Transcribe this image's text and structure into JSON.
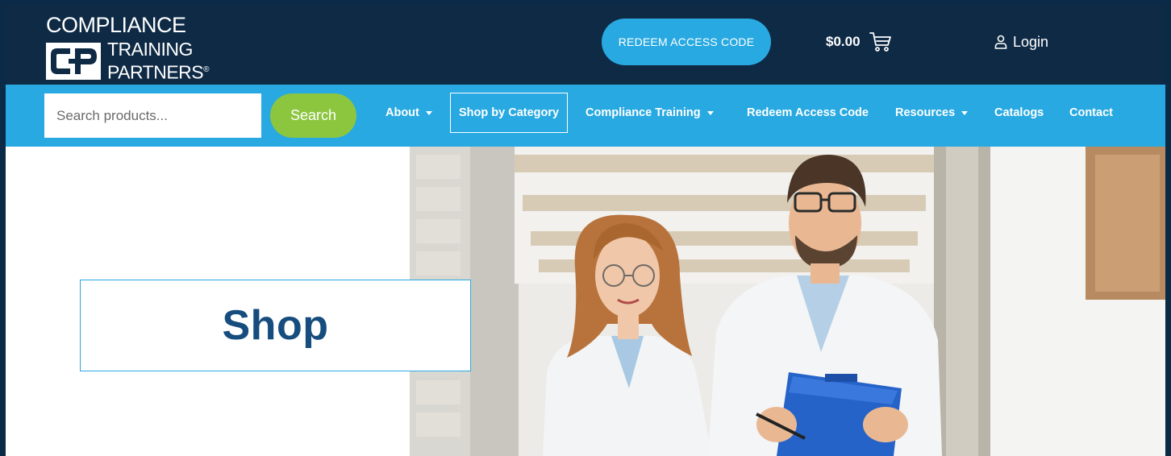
{
  "brand": {
    "line1": "COMPLIANCE",
    "line2": "TRAINING",
    "line3": "PARTNERS",
    "registered": "®"
  },
  "header": {
    "redeem_label": "REDEEM ACCESS CODE",
    "cart_amount": "$0.00",
    "login_label": "Login"
  },
  "search": {
    "placeholder": "Search products...",
    "button_label": "Search"
  },
  "nav": {
    "items": [
      {
        "label": "About",
        "dropdown": true
      },
      {
        "label": "Shop by Category",
        "dropdown": false
      },
      {
        "label": "Compliance Training",
        "dropdown": true
      },
      {
        "label": "Redeem Access Code",
        "dropdown": false
      },
      {
        "label": "Resources",
        "dropdown": true
      },
      {
        "label": "Catalogs",
        "dropdown": false
      },
      {
        "label": "Contact",
        "dropdown": false
      }
    ]
  },
  "hero": {
    "title": "Shop"
  },
  "colors": {
    "header_bg": "#0e2a45",
    "accent_blue": "#28a9e1",
    "search_green": "#8cc63f",
    "title_blue": "#164d7e"
  }
}
